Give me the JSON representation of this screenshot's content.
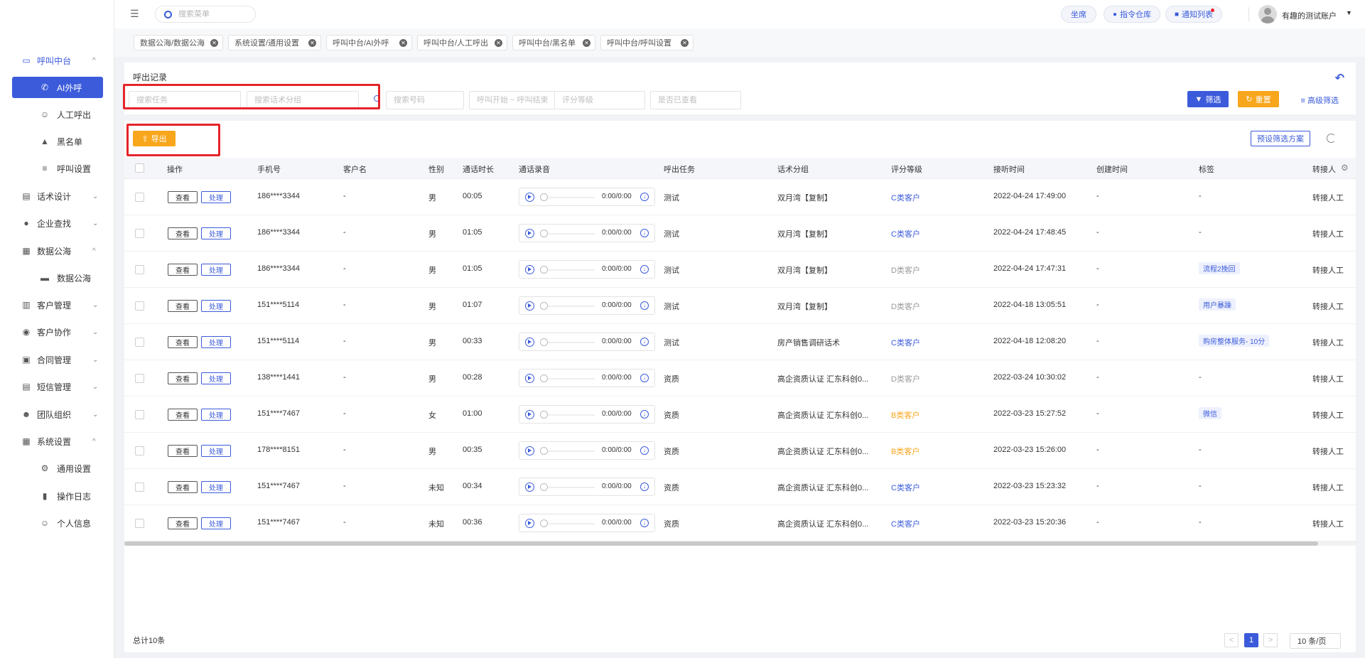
{
  "sidebar": {
    "items": [
      {
        "label": "呼叫中台",
        "icon": "monitor-icon",
        "chevron": "^",
        "type": "group-active"
      },
      {
        "label": "AI外呼",
        "icon": "phone-icon",
        "type": "selected"
      },
      {
        "label": "人工呼出",
        "icon": "person-icon",
        "type": "sub"
      },
      {
        "label": "黑名单",
        "icon": "warning-icon",
        "type": "sub"
      },
      {
        "label": "呼叫设置",
        "icon": "sliders-icon",
        "type": "sub"
      },
      {
        "label": "话术设计",
        "icon": "script-icon",
        "chevron": "⌄",
        "type": "group"
      },
      {
        "label": "企业查找",
        "icon": "bulb-icon",
        "chevron": "⌄",
        "type": "group"
      },
      {
        "label": "数据公海",
        "icon": "data-icon",
        "chevron": "^",
        "type": "group"
      },
      {
        "label": "数据公海",
        "icon": "sea-icon",
        "type": "sub"
      },
      {
        "label": "客户管理",
        "icon": "customer-icon",
        "chevron": "⌄",
        "type": "group"
      },
      {
        "label": "客户协作",
        "icon": "collab-icon",
        "chevron": "⌄",
        "type": "group"
      },
      {
        "label": "合同管理",
        "icon": "contract-icon",
        "chevron": "⌄",
        "type": "group"
      },
      {
        "label": "短信管理",
        "icon": "sms-icon",
        "chevron": "⌄",
        "type": "group"
      },
      {
        "label": "团队组织",
        "icon": "team-icon",
        "chevron": "⌄",
        "type": "group"
      },
      {
        "label": "系统设置",
        "icon": "grid-icon",
        "chevron": "^",
        "type": "group"
      },
      {
        "label": "通用设置",
        "icon": "gear-icon",
        "type": "sub"
      },
      {
        "label": "操作日志",
        "icon": "log-icon",
        "type": "sub"
      },
      {
        "label": "个人信息",
        "icon": "user-icon",
        "type": "sub"
      }
    ]
  },
  "topbar": {
    "search_placeholder": "搜索菜单",
    "seat_label": "坐席",
    "command_label": "指令仓库",
    "notify_label": "通知列表",
    "account_name": "有趣的测试账户"
  },
  "tabs": [
    "数据公海/数据公海",
    "系统设置/通用设置",
    "呼叫中台/AI外呼",
    "呼叫中台/人工呼出",
    "呼叫中台/黑名单",
    "呼叫中台/呼叫设置"
  ],
  "filter": {
    "title": "呼出记录",
    "task_placeholder": "搜索任务",
    "script_placeholder": "搜索话术分组",
    "number_placeholder": "搜索号码",
    "time_placeholder": "呼叫开始 ~ 呼叫结束",
    "grade_placeholder": "评分等级",
    "viewed_placeholder": "是否已查看",
    "filter_label": "筛选",
    "reset_label": "重置",
    "advanced_label": "高级筛选"
  },
  "toolbar": {
    "export_label": "导出",
    "preset_label": "预设筛选方案"
  },
  "table": {
    "headers": {
      "action": "操作",
      "phone": "手机号",
      "customer": "客户名",
      "gender": "性别",
      "duration": "通话时长",
      "recording": "通话录音",
      "task": "呼出任务",
      "script": "话术分组",
      "grade": "评分等级",
      "answer_time": "接听时间",
      "created_time": "创建时间",
      "tag": "标签",
      "transfer": "转接人"
    },
    "view_label": "查看",
    "handle_label": "处理",
    "rows": [
      {
        "phone": "186****3344",
        "customer": "-",
        "gender": "男",
        "duration": "00:05",
        "audio": "0:00/0:00",
        "task": "测试",
        "script": "双月湾【复制】",
        "grade": "C类客户",
        "grade_color": "#3b5bdb",
        "answer_time": "2022-04-24 17:49:00",
        "created": "-",
        "tag": "-",
        "transfer": "转接人工"
      },
      {
        "phone": "186****3344",
        "customer": "-",
        "gender": "男",
        "duration": "01:05",
        "audio": "0:00/0:00",
        "task": "测试",
        "script": "双月湾【复制】",
        "grade": "C类客户",
        "grade_color": "#3b5bdb",
        "answer_time": "2022-04-24 17:48:45",
        "created": "-",
        "tag": "-",
        "transfer": "转接人工"
      },
      {
        "phone": "186****3344",
        "customer": "-",
        "gender": "男",
        "duration": "01:05",
        "audio": "0:00/0:00",
        "task": "测试",
        "script": "双月湾【复制】",
        "grade": "D类客户",
        "grade_color": "#999999",
        "answer_time": "2022-04-24 17:47:31",
        "created": "-",
        "tag": "流程2挽回",
        "transfer": "转接人工"
      },
      {
        "phone": "151****5114",
        "customer": "-",
        "gender": "男",
        "duration": "01:07",
        "audio": "0:00/0:00",
        "task": "测试",
        "script": "双月湾【复制】",
        "grade": "D类客户",
        "grade_color": "#999999",
        "answer_time": "2022-04-18 13:05:51",
        "created": "-",
        "tag": "用户暴躁",
        "transfer": "转接人工"
      },
      {
        "phone": "151****5114",
        "customer": "-",
        "gender": "男",
        "duration": "00:33",
        "audio": "0:00/0:00",
        "task": "测试",
        "script": "房产销售调研话术",
        "grade": "C类客户",
        "grade_color": "#3b5bdb",
        "answer_time": "2022-04-18 12:08:20",
        "created": "-",
        "tag": "购房整体服务- 10分",
        "transfer": "转接人工"
      },
      {
        "phone": "138****1441",
        "customer": "-",
        "gender": "男",
        "duration": "00:28",
        "audio": "0:00/0:00",
        "task": "资质",
        "script": "高企资质认证 汇东科创0...",
        "grade": "D类客户",
        "grade_color": "#999999",
        "answer_time": "2022-03-24 10:30:02",
        "created": "-",
        "tag": "-",
        "transfer": "转接人工"
      },
      {
        "phone": "151****7467",
        "customer": "-",
        "gender": "女",
        "duration": "01:00",
        "audio": "0:00/0:00",
        "task": "资质",
        "script": "高企资质认证 汇东科创0...",
        "grade": "B类客户",
        "grade_color": "#f8a61c",
        "answer_time": "2022-03-23 15:27:52",
        "created": "-",
        "tag": "微信",
        "transfer": "转接人工"
      },
      {
        "phone": "178****8151",
        "customer": "-",
        "gender": "男",
        "duration": "00:35",
        "audio": "0:00/0:00",
        "task": "资质",
        "script": "高企资质认证 汇东科创0...",
        "grade": "B类客户",
        "grade_color": "#f8a61c",
        "answer_time": "2022-03-23 15:26:00",
        "created": "-",
        "tag": "-",
        "transfer": "转接人工"
      },
      {
        "phone": "151****7467",
        "customer": "-",
        "gender": "未知",
        "duration": "00:34",
        "audio": "0:00/0:00",
        "task": "资质",
        "script": "高企资质认证 汇东科创0...",
        "grade": "C类客户",
        "grade_color": "#3b5bdb",
        "answer_time": "2022-03-23 15:23:32",
        "created": "-",
        "tag": "-",
        "transfer": "转接人工"
      },
      {
        "phone": "151****7467",
        "customer": "-",
        "gender": "未知",
        "duration": "00:36",
        "audio": "0:00/0:00",
        "task": "资质",
        "script": "高企资质认证 汇东科创0...",
        "grade": "C类客户",
        "grade_color": "#3b5bdb",
        "answer_time": "2022-03-23 15:20:36",
        "created": "-",
        "tag": "-",
        "transfer": "转接人工"
      }
    ]
  },
  "pagination": {
    "total": "总计10条",
    "prev": "<",
    "current": "1",
    "next": ">",
    "page_size": "10 条/页"
  },
  "colors": {
    "primary": "#3b5bdb",
    "accent": "#f8a61c",
    "highlight": "#e5242b"
  }
}
